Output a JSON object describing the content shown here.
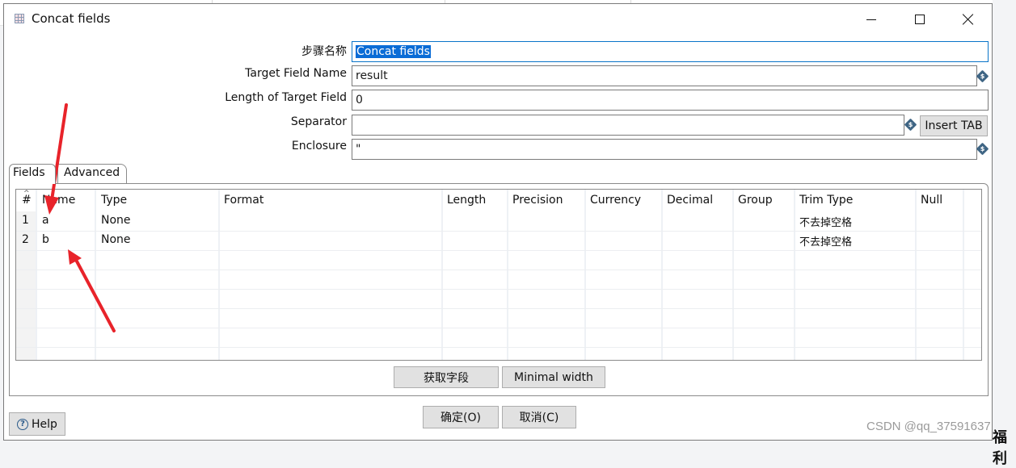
{
  "window": {
    "title": "Concat fields",
    "icon": "table-grid-icon",
    "controls": {
      "minimize": "minimize-icon",
      "maximize": "maximize-icon",
      "close": "close-icon"
    }
  },
  "form": {
    "step_name": {
      "label": "步骤名称",
      "value": "Concat fields"
    },
    "target_field_name": {
      "label": "Target Field Name",
      "value": "result",
      "variable_icon": "variable-diamond-icon"
    },
    "length_of_target_field": {
      "label": "Length of Target Field",
      "value": "0"
    },
    "separator": {
      "label": "Separator",
      "value": "",
      "variable_icon": "variable-diamond-icon",
      "insert_tab_label": "Insert TAB"
    },
    "enclosure": {
      "label": "Enclosure",
      "value": "\"",
      "variable_icon": "variable-diamond-icon"
    }
  },
  "tabs": [
    {
      "label": "Fields",
      "active": true
    },
    {
      "label": "Advanced",
      "active": false
    }
  ],
  "table": {
    "sort_indicator": "^",
    "columns": [
      "#",
      "Name",
      "Type",
      "Format",
      "Length",
      "Precision",
      "Currency",
      "Decimal",
      "Group",
      "Trim Type",
      "Null"
    ],
    "rows": [
      {
        "num": "1",
        "name": "a",
        "type": "None",
        "format": "",
        "length": "",
        "precision": "",
        "currency": "",
        "decimal": "",
        "group": "",
        "trim_type": "不去掉空格",
        "null": ""
      },
      {
        "num": "2",
        "name": "b",
        "type": "None",
        "format": "",
        "length": "",
        "precision": "",
        "currency": "",
        "decimal": "",
        "group": "",
        "trim_type": "不去掉空格",
        "null": ""
      }
    ]
  },
  "table_buttons": {
    "get_fields": "获取字段",
    "minimal_width": "Minimal width"
  },
  "dialog_buttons": {
    "ok": "确定(O)",
    "cancel": "取消(C)",
    "help": "Help"
  },
  "annotation": {
    "arrow_color": "#e8232a"
  },
  "watermark": {
    "text": "CSDN @qq_37591637",
    "underlay_text": "福利"
  },
  "colors": {
    "focus_border": "#0a74c8",
    "selection": "#0a6cd6",
    "variable_icon": "#3f6584"
  }
}
